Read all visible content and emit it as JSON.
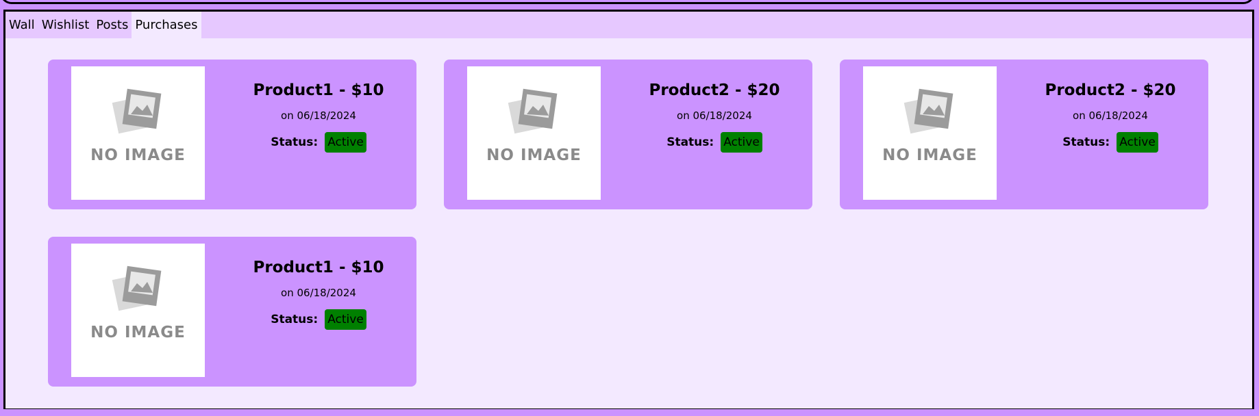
{
  "tabs": [
    {
      "label": "Wall"
    },
    {
      "label": "Wishlist"
    },
    {
      "label": "Posts"
    },
    {
      "label": "Purchases"
    }
  ],
  "active_tab": "Purchases",
  "cards": [
    {
      "title": "Product1 - $10",
      "date": "on 06/18/2024",
      "status_label": "Status:",
      "status": "Active",
      "image_text": "NO IMAGE"
    },
    {
      "title": "Product2 - $20",
      "date": "on 06/18/2024",
      "status_label": "Status:",
      "status": "Active",
      "image_text": "NO IMAGE"
    },
    {
      "title": "Product2 - $20",
      "date": "on 06/18/2024",
      "status_label": "Status:",
      "status": "Active",
      "image_text": "NO IMAGE"
    },
    {
      "title": "Product1 - $10",
      "date": "on 06/18/2024",
      "status_label": "Status:",
      "status": "Active",
      "image_text": "NO IMAGE"
    }
  ],
  "colors": {
    "background": "#cb93ff",
    "panel": "#f3e9ff",
    "tabbar": "#e6c8ff",
    "card": "#cb93ff",
    "status_active": "#008000"
  },
  "icons": {
    "placeholder": "no-image-icon"
  }
}
